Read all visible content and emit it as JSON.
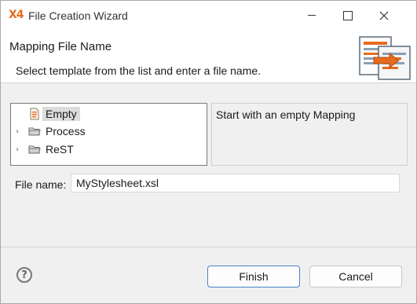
{
  "window": {
    "title": "File Creation Wizard",
    "app_icon_text": "X4"
  },
  "header": {
    "title": "Mapping File Name",
    "description": "Select template from the list and enter a file name."
  },
  "tree": {
    "items": [
      {
        "label": "Empty",
        "icon": "document-icon",
        "selected": true,
        "expandable": false
      },
      {
        "label": "Process",
        "icon": "folder-icon",
        "selected": false,
        "expandable": true
      },
      {
        "label": "ReST",
        "icon": "folder-icon",
        "selected": false,
        "expandable": true
      }
    ]
  },
  "description_panel": {
    "text": "Start with an empty Mapping"
  },
  "file_name": {
    "label": "File name:",
    "value": "MyStylesheet.xsl"
  },
  "footer": {
    "help_symbol": "?",
    "finish_label": "Finish",
    "cancel_label": "Cancel"
  },
  "colors": {
    "accent": "#e66b1e",
    "default_button_border": "#4b82c7"
  }
}
